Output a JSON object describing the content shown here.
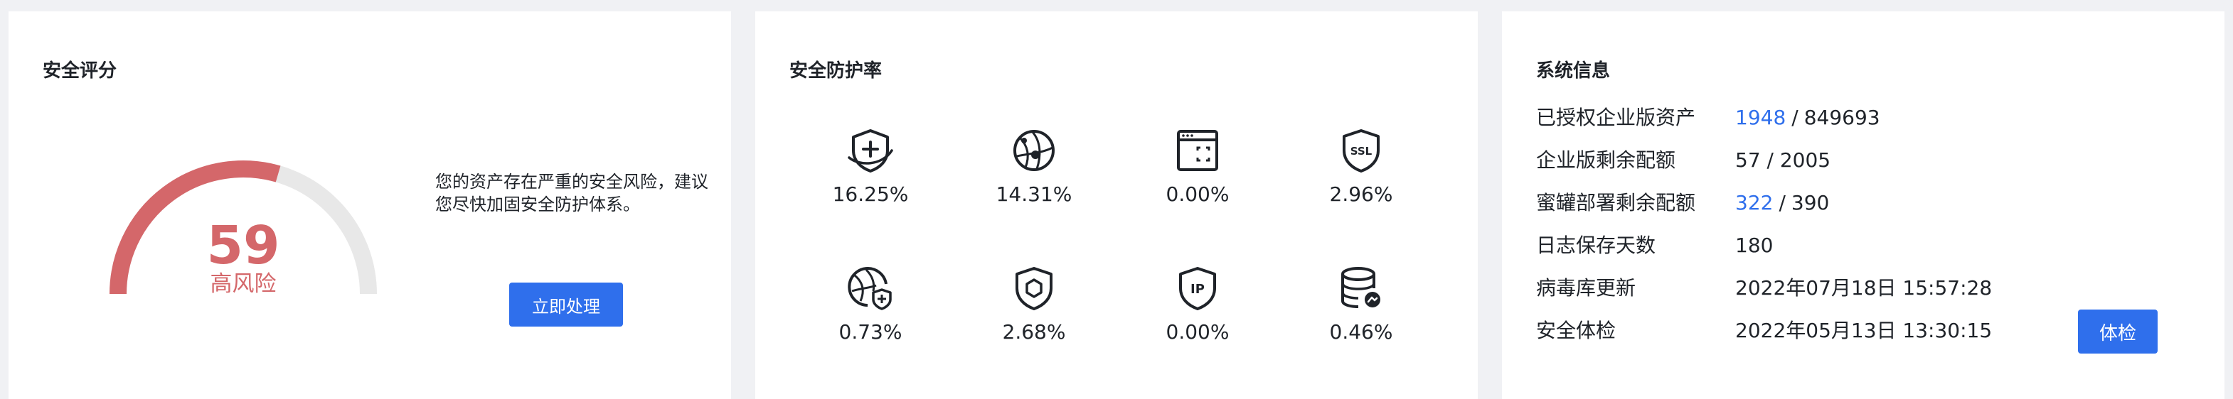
{
  "score_card": {
    "title": "安全评分",
    "score": "59",
    "level": "高风险",
    "score_max": 100,
    "score_color": "#d4676a",
    "description": "您的资产存在严重的安全风险，建议您尽快加固安全防护体系。",
    "action_label": "立即处理"
  },
  "protection_card": {
    "title": "安全防护率",
    "items": [
      {
        "icon": "shield-plus-icon",
        "value": "16.25%"
      },
      {
        "icon": "globe-network-icon",
        "value": "14.31%"
      },
      {
        "icon": "browser-window-icon",
        "value": "0.00%"
      },
      {
        "icon": "ssl-shield-icon",
        "value": "2.96%"
      },
      {
        "icon": "globe-shield-icon",
        "value": "0.73%"
      },
      {
        "icon": "hexagon-shield-icon",
        "value": "2.68%"
      },
      {
        "icon": "ip-shield-icon",
        "value": "0.00%"
      },
      {
        "icon": "database-icon",
        "value": "0.46%"
      }
    ]
  },
  "system_card": {
    "title": "系统信息",
    "rows": [
      {
        "label": "已授权企业版资产",
        "used": "1948",
        "sep": "/",
        "total": "849693"
      },
      {
        "label": "企业版剩余配额",
        "value": "57 / 2005"
      },
      {
        "label": "蜜罐部署剩余配额",
        "used": "322",
        "sep": "/",
        "total": "390"
      },
      {
        "label": "日志保存天数",
        "value": "180"
      },
      {
        "label": "病毒库更新",
        "value": "2022年07月18日 15:57:28"
      },
      {
        "label": "安全体检",
        "value": "2022年05月13日 13:30:15"
      }
    ],
    "checkup_label": "体检"
  },
  "colors": {
    "accent": "#2f6fec",
    "risk": "#d4676a",
    "gauge_track": "#e8e8e8",
    "background": "#f0f1f4"
  }
}
